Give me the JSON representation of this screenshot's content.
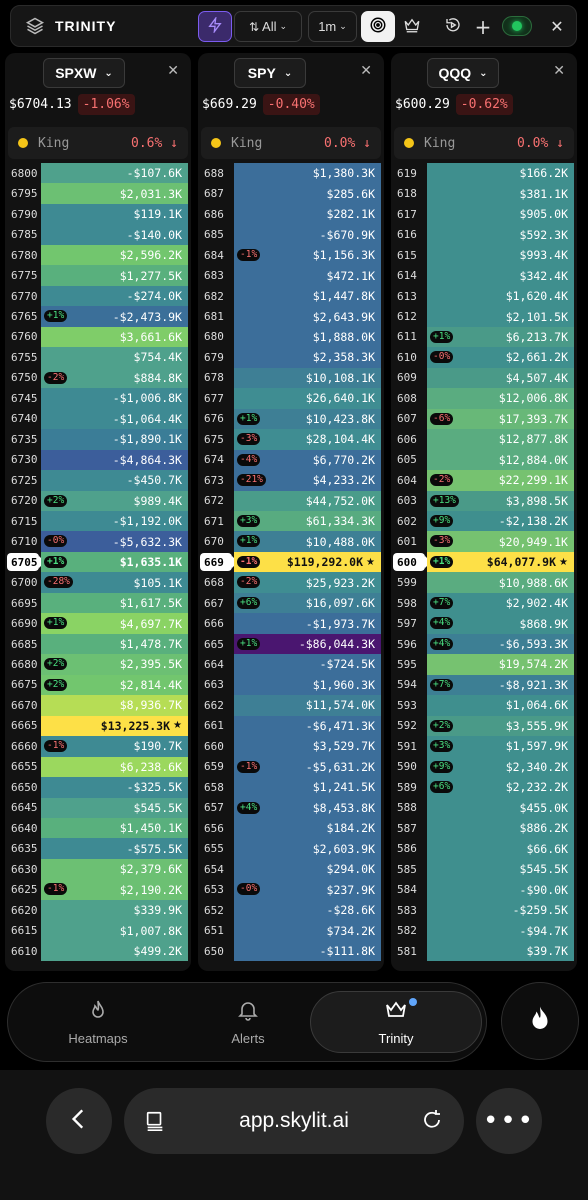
{
  "header": {
    "title": "TRINITY",
    "sort_label": "All",
    "interval_label": "1m"
  },
  "panels": [
    {
      "symbol": "SPXW",
      "price": "$6704.13",
      "change": "-1.06%",
      "king_label": "King",
      "king_value": "0.6% ↓",
      "rows": [
        {
          "strike": "6800",
          "value": "-$107.6K",
          "color": "#4fa18c"
        },
        {
          "strike": "6795",
          "value": "$2,031.3K",
          "color": "#6cc073"
        },
        {
          "strike": "6790",
          "value": "$119.1K",
          "color": "#3e8a93"
        },
        {
          "strike": "6785",
          "value": "-$140.0K",
          "color": "#3e8a93"
        },
        {
          "strike": "6780",
          "value": "$2,596.2K",
          "color": "#72c66e"
        },
        {
          "strike": "6775",
          "value": "$1,277.5K",
          "color": "#59b07d"
        },
        {
          "strike": "6770",
          "value": "-$274.0K",
          "color": "#3e8a93"
        },
        {
          "strike": "6765",
          "value": "-$2,473.9K",
          "color": "#3b6f99",
          "badge": "+1%"
        },
        {
          "strike": "6760",
          "value": "$3,661.6K",
          "color": "#7fcd69"
        },
        {
          "strike": "6755",
          "value": "$754.4K",
          "color": "#4fa18c"
        },
        {
          "strike": "6750",
          "value": "$884.8K",
          "color": "#4fa18c",
          "badge": "-2%"
        },
        {
          "strike": "6745",
          "value": "-$1,006.8K",
          "color": "#3e8a93"
        },
        {
          "strike": "6740",
          "value": "-$1,064.4K",
          "color": "#3e8a93"
        },
        {
          "strike": "6735",
          "value": "-$1,890.1K",
          "color": "#3b7d97"
        },
        {
          "strike": "6730",
          "value": "-$4,864.3K",
          "color": "#3c5e9b"
        },
        {
          "strike": "6725",
          "value": "-$450.7K",
          "color": "#3e8a93"
        },
        {
          "strike": "6720",
          "value": "$989.4K",
          "color": "#4fa18c",
          "badge": "+2%"
        },
        {
          "strike": "6715",
          "value": "-$1,192.0K",
          "color": "#3e8a93"
        },
        {
          "strike": "6710",
          "value": "-$5,632.3K",
          "color": "#3c5e9b",
          "badge": "-0%"
        },
        {
          "strike": "6705",
          "value": "$1,635.1K",
          "color": "#59b07d",
          "badge": "+1%",
          "current": true
        },
        {
          "strike": "6700",
          "value": "$105.1K",
          "color": "#3e8a93",
          "badge": "-28%"
        },
        {
          "strike": "6695",
          "value": "$1,617.5K",
          "color": "#59b07d"
        },
        {
          "strike": "6690",
          "value": "$4,697.7K",
          "color": "#8ad364",
          "badge": "+1%"
        },
        {
          "strike": "6685",
          "value": "$1,478.7K",
          "color": "#59b07d"
        },
        {
          "strike": "6680",
          "value": "$2,395.5K",
          "color": "#6cc073",
          "badge": "+2%"
        },
        {
          "strike": "6675",
          "value": "$2,814.4K",
          "color": "#72c66e",
          "badge": "+2%"
        },
        {
          "strike": "6670",
          "value": "$8,936.7K",
          "color": "#b6dd55"
        },
        {
          "strike": "6665",
          "value": "$13,225.3K",
          "color": "#fde047",
          "king": true
        },
        {
          "strike": "6660",
          "value": "$190.7K",
          "color": "#3e8a93",
          "badge": "-1%"
        },
        {
          "strike": "6655",
          "value": "$6,238.6K",
          "color": "#9bd85e"
        },
        {
          "strike": "6650",
          "value": "-$325.5K",
          "color": "#3e8a93"
        },
        {
          "strike": "6645",
          "value": "$545.5K",
          "color": "#4fa18c"
        },
        {
          "strike": "6640",
          "value": "$1,450.1K",
          "color": "#59b07d"
        },
        {
          "strike": "6635",
          "value": "-$575.5K",
          "color": "#3e8a93"
        },
        {
          "strike": "6630",
          "value": "$2,379.6K",
          "color": "#6cc073"
        },
        {
          "strike": "6625",
          "value": "$2,190.2K",
          "color": "#6cc073",
          "badge": "-1%"
        },
        {
          "strike": "6620",
          "value": "$339.9K",
          "color": "#4fa18c"
        },
        {
          "strike": "6615",
          "value": "$1,007.8K",
          "color": "#4fa18c"
        },
        {
          "strike": "6610",
          "value": "$499.2K",
          "color": "#4fa18c"
        }
      ]
    },
    {
      "symbol": "SPY",
      "price": "$669.29",
      "change": "-0.40%",
      "king_label": "King",
      "king_value": "0.0% ↓",
      "rows": [
        {
          "strike": "688",
          "value": "$1,380.3K",
          "color": "#3c6e9a"
        },
        {
          "strike": "687",
          "value": "$285.6K",
          "color": "#3c6e9a"
        },
        {
          "strike": "686",
          "value": "$282.1K",
          "color": "#3c6e9a"
        },
        {
          "strike": "685",
          "value": "-$670.9K",
          "color": "#3c6e9a"
        },
        {
          "strike": "684",
          "value": "$1,156.3K",
          "color": "#3c6e9a",
          "badge": "-1%"
        },
        {
          "strike": "683",
          "value": "$472.1K",
          "color": "#3c6e9a"
        },
        {
          "strike": "682",
          "value": "$1,447.8K",
          "color": "#3c6e9a"
        },
        {
          "strike": "681",
          "value": "$2,643.9K",
          "color": "#3c6e9a"
        },
        {
          "strike": "680",
          "value": "$1,888.0K",
          "color": "#3c6e9a"
        },
        {
          "strike": "679",
          "value": "$2,358.3K",
          "color": "#3c6e9a"
        },
        {
          "strike": "678",
          "value": "$10,108.1K",
          "color": "#3e7f95"
        },
        {
          "strike": "677",
          "value": "$26,640.1K",
          "color": "#3f8d92"
        },
        {
          "strike": "676",
          "value": "$10,423.8K",
          "color": "#3e7f95",
          "badge": "+1%"
        },
        {
          "strike": "675",
          "value": "$28,104.4K",
          "color": "#3f8d92",
          "badge": "-3%"
        },
        {
          "strike": "674",
          "value": "$6,770.2K",
          "color": "#3c6e9a",
          "badge": "-4%"
        },
        {
          "strike": "673",
          "value": "$4,233.2K",
          "color": "#3c6e9a",
          "badge": "-21%"
        },
        {
          "strike": "672",
          "value": "$44,752.0K",
          "color": "#4a9c8a"
        },
        {
          "strike": "671",
          "value": "$61,334.3K",
          "color": "#58ab80",
          "badge": "+3%"
        },
        {
          "strike": "670",
          "value": "$10,488.0K",
          "color": "#3e7f95",
          "badge": "+1%"
        },
        {
          "strike": "669",
          "value": "$119,292.0K",
          "color": "#fde047",
          "badge": "-1%",
          "current": true,
          "king": true
        },
        {
          "strike": "668",
          "value": "$25,923.2K",
          "color": "#3f8d92",
          "badge": "-2%"
        },
        {
          "strike": "667",
          "value": "$16,097.6K",
          "color": "#3e7f95",
          "badge": "+6%"
        },
        {
          "strike": "666",
          "value": "-$1,973.7K",
          "color": "#3c6e9a"
        },
        {
          "strike": "665",
          "value": "-$86,044.3K",
          "color": "#4a1670",
          "badge": "+1%"
        },
        {
          "strike": "664",
          "value": "-$724.5K",
          "color": "#3c6e9a"
        },
        {
          "strike": "663",
          "value": "$1,960.3K",
          "color": "#3c6e9a"
        },
        {
          "strike": "662",
          "value": "$11,574.0K",
          "color": "#3e7f95"
        },
        {
          "strike": "661",
          "value": "-$6,471.3K",
          "color": "#3c6e9a"
        },
        {
          "strike": "660",
          "value": "$3,529.7K",
          "color": "#3c6e9a"
        },
        {
          "strike": "659",
          "value": "-$5,631.2K",
          "color": "#3c6e9a",
          "badge": "-1%"
        },
        {
          "strike": "658",
          "value": "$1,241.5K",
          "color": "#3c6e9a"
        },
        {
          "strike": "657",
          "value": "$8,453.8K",
          "color": "#3c6e9a",
          "badge": "+4%"
        },
        {
          "strike": "656",
          "value": "$184.2K",
          "color": "#3c6e9a"
        },
        {
          "strike": "655",
          "value": "$2,603.9K",
          "color": "#3c6e9a"
        },
        {
          "strike": "654",
          "value": "$294.0K",
          "color": "#3c6e9a"
        },
        {
          "strike": "653",
          "value": "$237.9K",
          "color": "#3c6e9a",
          "badge": "-0%"
        },
        {
          "strike": "652",
          "value": "-$28.6K",
          "color": "#3c6e9a"
        },
        {
          "strike": "651",
          "value": "$734.2K",
          "color": "#3c6e9a"
        },
        {
          "strike": "650",
          "value": "-$111.8K",
          "color": "#3c6e9a"
        }
      ]
    },
    {
      "symbol": "QQQ",
      "price": "$600.29",
      "change": "-0.62%",
      "king_label": "King",
      "king_value": "0.0% ↓",
      "rows": [
        {
          "strike": "619",
          "value": "$166.2K",
          "color": "#3f8f8e"
        },
        {
          "strike": "618",
          "value": "$381.1K",
          "color": "#3f8f8e"
        },
        {
          "strike": "617",
          "value": "$905.0K",
          "color": "#3f8f8e"
        },
        {
          "strike": "616",
          "value": "$592.3K",
          "color": "#3f8f8e"
        },
        {
          "strike": "615",
          "value": "$993.4K",
          "color": "#3f8f8e"
        },
        {
          "strike": "614",
          "value": "$342.4K",
          "color": "#3f8f8e"
        },
        {
          "strike": "613",
          "value": "$1,620.4K",
          "color": "#3f8f8e"
        },
        {
          "strike": "612",
          "value": "$2,101.5K",
          "color": "#3f8f8e"
        },
        {
          "strike": "611",
          "value": "$6,213.7K",
          "color": "#4a9a88",
          "badge": "+1%"
        },
        {
          "strike": "610",
          "value": "$2,661.2K",
          "color": "#3f8f8e",
          "badge": "-0%"
        },
        {
          "strike": "609",
          "value": "$4,507.4K",
          "color": "#4a9a88"
        },
        {
          "strike": "608",
          "value": "$12,006.8K",
          "color": "#5aac80"
        },
        {
          "strike": "607",
          "value": "$17,393.7K",
          "color": "#68b878",
          "badge": "-6%"
        },
        {
          "strike": "606",
          "value": "$12,877.8K",
          "color": "#5aac80"
        },
        {
          "strike": "605",
          "value": "$12,884.0K",
          "color": "#5aac80"
        },
        {
          "strike": "604",
          "value": "$22,299.1K",
          "color": "#76c270",
          "badge": "-2%"
        },
        {
          "strike": "603",
          "value": "$3,898.5K",
          "color": "#4a9a88",
          "badge": "+13%"
        },
        {
          "strike": "602",
          "value": "-$2,138.2K",
          "color": "#3f8f8e",
          "badge": "+9%"
        },
        {
          "strike": "601",
          "value": "$20,949.1K",
          "color": "#76c270",
          "badge": "-3%"
        },
        {
          "strike": "600",
          "value": "$64,077.9K",
          "color": "#fde047",
          "badge": "+1%",
          "current": true,
          "king": true
        },
        {
          "strike": "599",
          "value": "$10,988.6K",
          "color": "#5aac80"
        },
        {
          "strike": "598",
          "value": "$2,902.4K",
          "color": "#3f8f8e",
          "badge": "+7%"
        },
        {
          "strike": "597",
          "value": "$868.9K",
          "color": "#3f8f8e",
          "badge": "+4%"
        },
        {
          "strike": "596",
          "value": "-$6,593.3K",
          "color": "#3d7f94",
          "badge": "+4%"
        },
        {
          "strike": "595",
          "value": "$19,574.2K",
          "color": "#76c270"
        },
        {
          "strike": "594",
          "value": "-$8,921.3K",
          "color": "#3d7f94",
          "badge": "+7%"
        },
        {
          "strike": "593",
          "value": "$1,064.6K",
          "color": "#3f8f8e"
        },
        {
          "strike": "592",
          "value": "$3,555.9K",
          "color": "#4a9a88",
          "badge": "+2%"
        },
        {
          "strike": "591",
          "value": "$1,597.9K",
          "color": "#3f8f8e",
          "badge": "+3%"
        },
        {
          "strike": "590",
          "value": "$2,340.2K",
          "color": "#3f8f8e",
          "badge": "+9%"
        },
        {
          "strike": "589",
          "value": "$2,232.2K",
          "color": "#3f8f8e",
          "badge": "+6%"
        },
        {
          "strike": "588",
          "value": "$455.0K",
          "color": "#3f8f8e"
        },
        {
          "strike": "587",
          "value": "$886.2K",
          "color": "#3f8f8e"
        },
        {
          "strike": "586",
          "value": "$66.6K",
          "color": "#3f8f8e"
        },
        {
          "strike": "585",
          "value": "$545.5K",
          "color": "#3f8f8e"
        },
        {
          "strike": "584",
          "value": "-$90.0K",
          "color": "#3f8f8e"
        },
        {
          "strike": "583",
          "value": "-$259.5K",
          "color": "#3f8f8e"
        },
        {
          "strike": "582",
          "value": "-$94.7K",
          "color": "#3f8f8e"
        },
        {
          "strike": "581",
          "value": "$39.7K",
          "color": "#3f8f8e"
        }
      ]
    }
  ],
  "nav": {
    "heatmaps": "Heatmaps",
    "alerts": "Alerts",
    "trinity": "Trinity"
  },
  "browser": {
    "url": "app.skylit.ai"
  }
}
